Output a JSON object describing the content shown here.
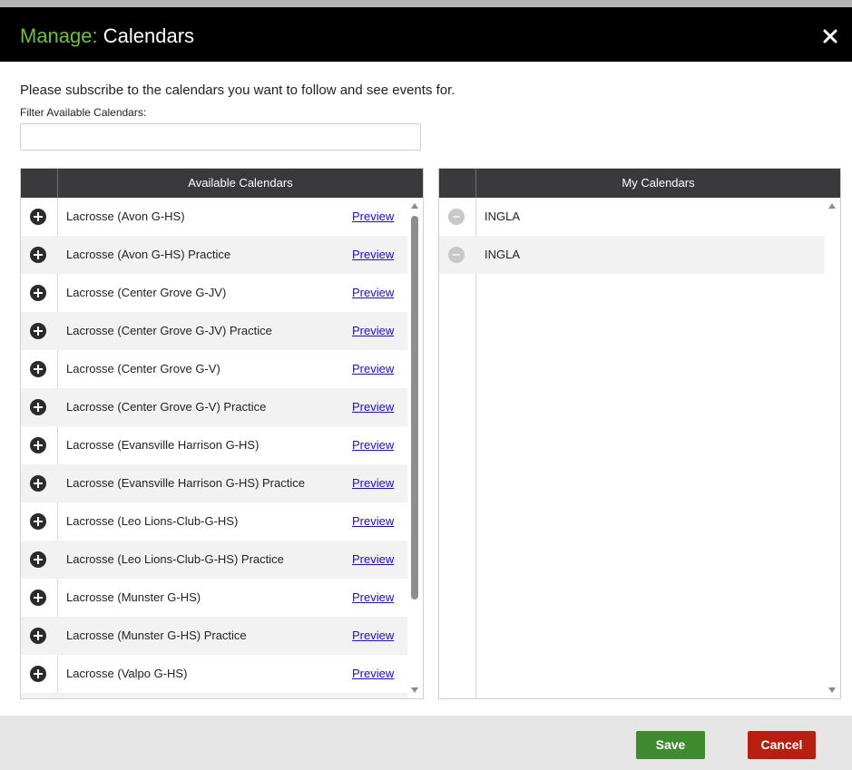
{
  "dialog": {
    "title_prefix": "Manage:",
    "title_main": " Calendars",
    "close_icon": "close-icon"
  },
  "instructions": "Please subscribe to the calendars you want to follow and see events for.",
  "filter": {
    "label": "Filter Available Calendars:",
    "value": "",
    "placeholder": ""
  },
  "available": {
    "header": "Available Calendars",
    "preview_label": "Preview",
    "items": [
      {
        "label": "Lacrosse (Avon G-HS)"
      },
      {
        "label": "Lacrosse (Avon G-HS) Practice"
      },
      {
        "label": "Lacrosse (Center Grove G-JV)"
      },
      {
        "label": "Lacrosse (Center Grove G-JV) Practice"
      },
      {
        "label": "Lacrosse (Center Grove G-V)"
      },
      {
        "label": "Lacrosse (Center Grove G-V) Practice"
      },
      {
        "label": "Lacrosse (Evansville Harrison G-HS)"
      },
      {
        "label": "Lacrosse (Evansville Harrison G-HS) Practice"
      },
      {
        "label": "Lacrosse (Leo Lions-Club-G-HS)"
      },
      {
        "label": "Lacrosse (Leo Lions-Club-G-HS) Practice"
      },
      {
        "label": "Lacrosse (Munster G-HS)"
      },
      {
        "label": "Lacrosse (Munster G-HS) Practice"
      },
      {
        "label": "Lacrosse (Valpo G-HS)"
      },
      {
        "label": ""
      }
    ]
  },
  "mine": {
    "header": "My Calendars",
    "items": [
      {
        "label": "INGLA"
      },
      {
        "label": "INGLA"
      }
    ]
  },
  "footer": {
    "save_label": "Save",
    "cancel_label": "Cancel"
  },
  "colors": {
    "title_accent": "#6fbf3f",
    "save": "#3f8b2f",
    "cancel": "#b81f0e",
    "link": "#1a0dcc"
  }
}
